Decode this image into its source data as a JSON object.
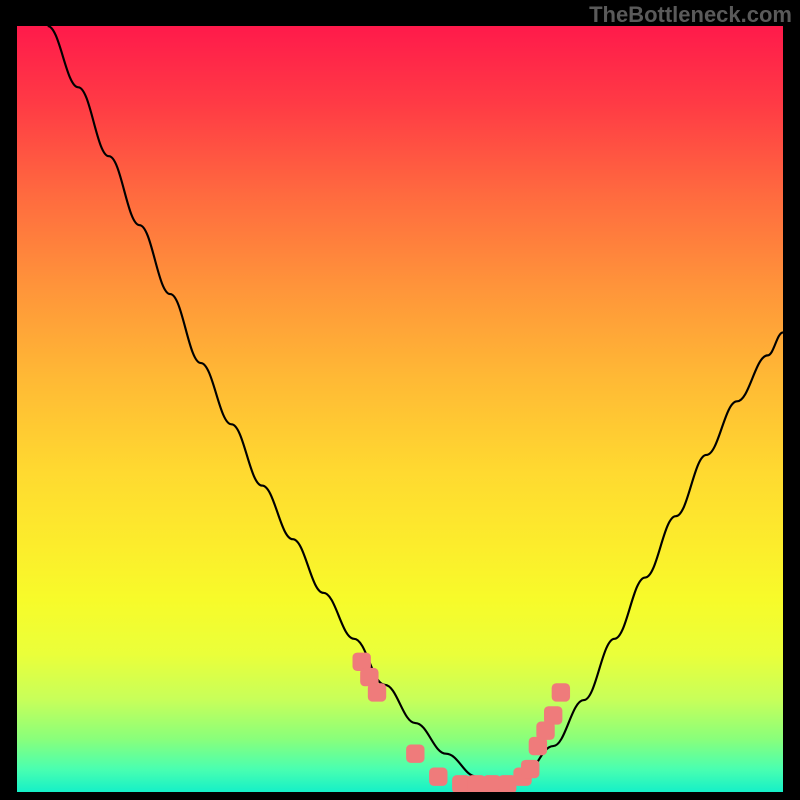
{
  "watermark": "TheBottleneck.com",
  "chart_data": {
    "type": "line",
    "title": "",
    "xlabel": "",
    "ylabel": "",
    "xlim": [
      0,
      100
    ],
    "ylim": [
      0,
      100
    ],
    "series": [
      {
        "name": "bottleneck-curve",
        "x": [
          4,
          8,
          12,
          16,
          20,
          24,
          28,
          32,
          36,
          40,
          44,
          48,
          52,
          56,
          60,
          62,
          64,
          66,
          70,
          74,
          78,
          82,
          86,
          90,
          94,
          98,
          100
        ],
        "y": [
          100,
          92,
          83,
          74,
          65,
          56,
          48,
          40,
          33,
          26,
          20,
          14,
          9,
          5,
          2,
          1,
          1,
          2,
          6,
          12,
          20,
          28,
          36,
          44,
          51,
          57,
          60
        ]
      }
    ],
    "highlight_points": {
      "name": "measured-points",
      "x": [
        45,
        46,
        47,
        52,
        55,
        58,
        60,
        62,
        64,
        66,
        67,
        68,
        69,
        70,
        71
      ],
      "y": [
        17,
        15,
        13,
        5,
        2,
        1,
        1,
        1,
        1,
        2,
        3,
        6,
        8,
        10,
        13
      ]
    },
    "gradient_stops": [
      {
        "pos": 0,
        "color": "#ff1a4b"
      },
      {
        "pos": 50,
        "color": "#ffd930"
      },
      {
        "pos": 80,
        "color": "#eaff3a"
      },
      {
        "pos": 100,
        "color": "#15f0c8"
      }
    ]
  }
}
